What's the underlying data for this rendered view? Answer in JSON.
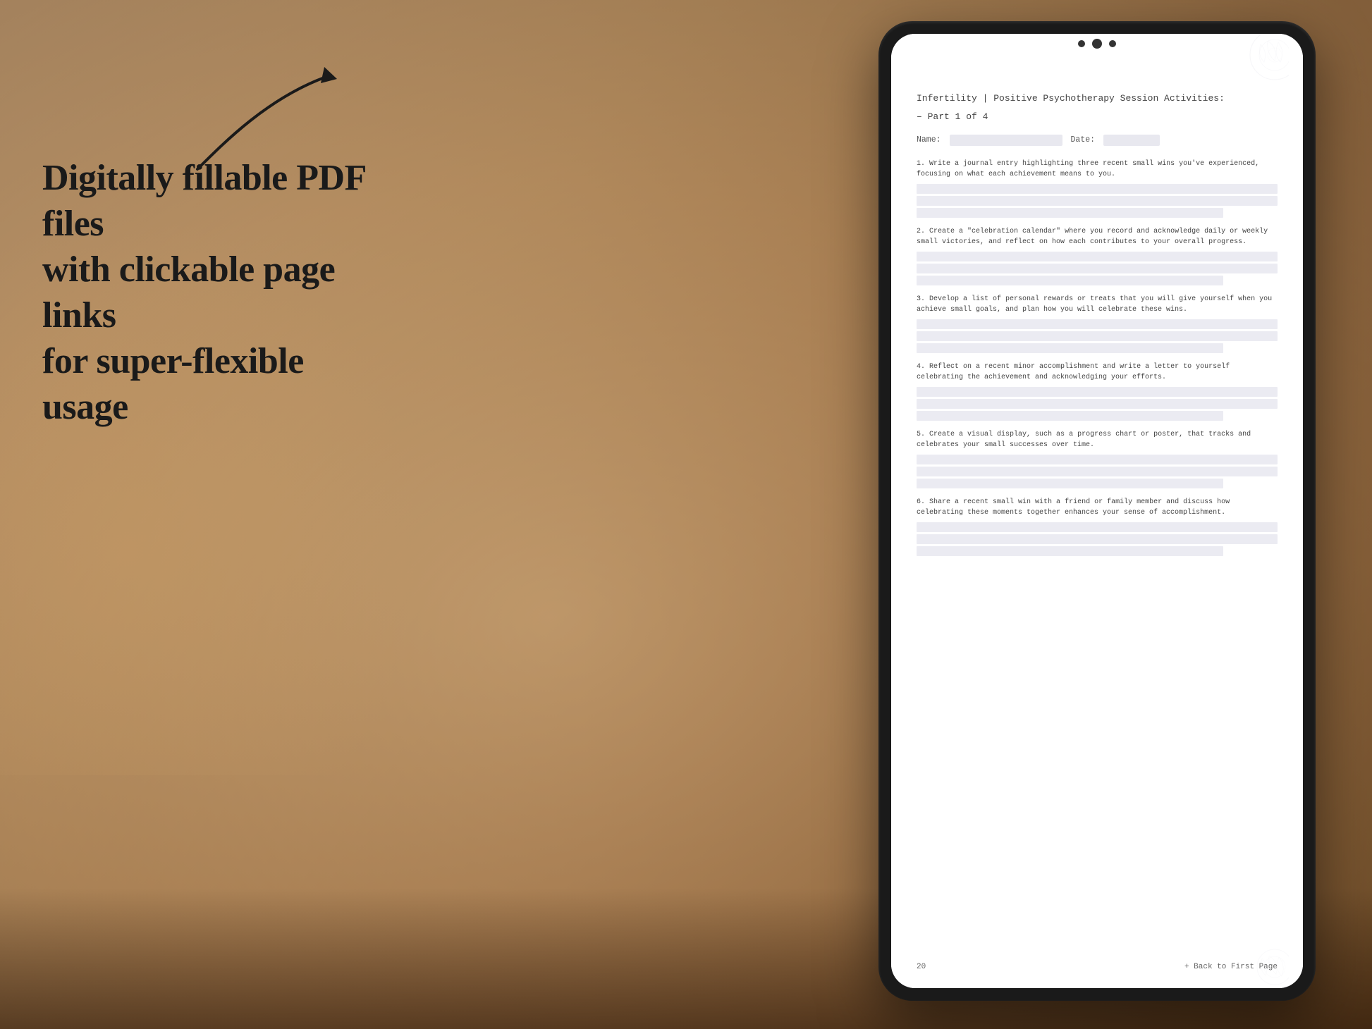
{
  "background": {
    "color": "#b8956a"
  },
  "left_text": {
    "line1": "Digitally fillable PDF files",
    "line2": "with clickable page links",
    "line3": "for super-flexible usage"
  },
  "arrow": {
    "label": "curved arrow pointing right"
  },
  "tablet": {
    "screen": {
      "document": {
        "title": "Infertility | Positive Psychotherapy Session Activities:",
        "subtitle": "– Part 1 of 4",
        "name_label": "Name:",
        "date_label": "Date:",
        "questions": [
          {
            "number": "1.",
            "text": "Write a journal entry highlighting three recent small wins you've experienced, focusing on what each achievement means to you."
          },
          {
            "number": "2.",
            "text": "Create a \"celebration calendar\" where you record and acknowledge daily or weekly small victories, and reflect on how each contributes to your overall progress."
          },
          {
            "number": "3.",
            "text": "Develop a list of personal rewards or treats that you will give yourself when you achieve small goals, and plan how you will celebrate these wins."
          },
          {
            "number": "4.",
            "text": "Reflect on a recent minor accomplishment and write a letter to yourself celebrating the achievement and acknowledging your efforts."
          },
          {
            "number": "5.",
            "text": "Create a visual display, such as a progress chart or poster, that tracks and celebrates your small successes over time."
          },
          {
            "number": "6.",
            "text": "Share a recent small win with a friend or family member and discuss how celebrating these moments together enhances your sense of accomplishment."
          }
        ],
        "page_number": "20",
        "back_link": "+ Back to First Page"
      }
    }
  }
}
